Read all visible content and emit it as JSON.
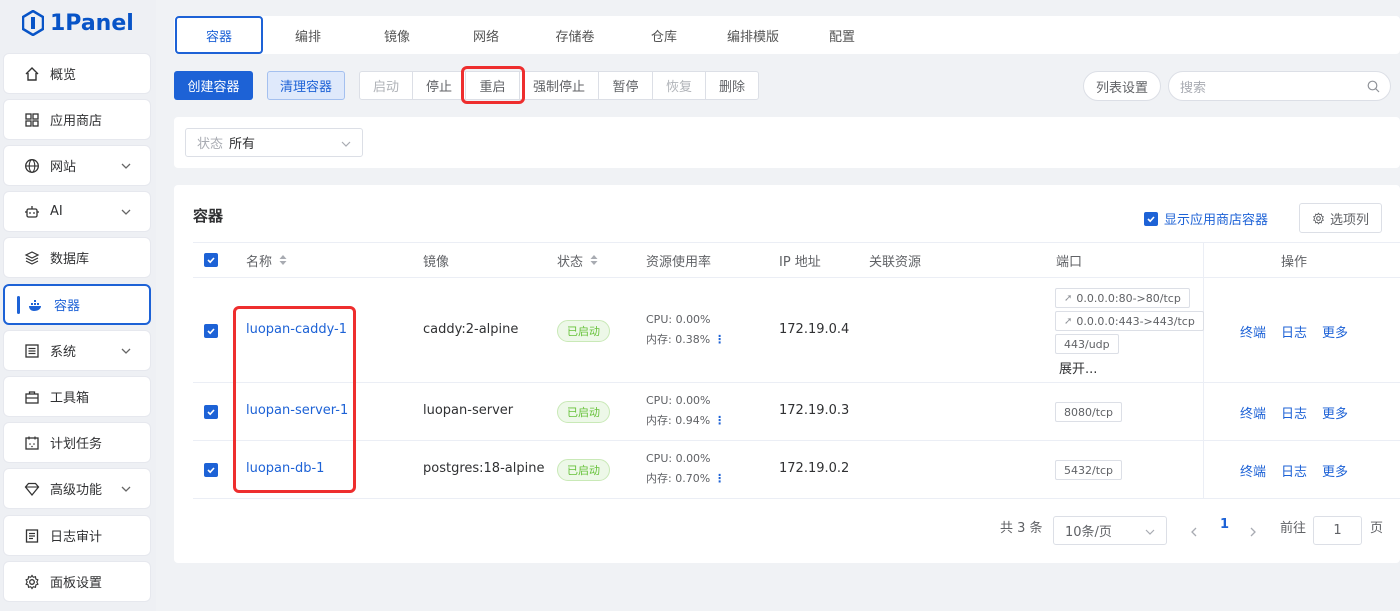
{
  "app": {
    "name": "1Panel"
  },
  "sidebar": {
    "items": [
      {
        "label": "概览",
        "icon": "home-icon"
      },
      {
        "label": "应用商店",
        "icon": "grid-icon"
      },
      {
        "label": "网站",
        "icon": "globe-icon",
        "expandable": true
      },
      {
        "label": "AI",
        "icon": "robot-icon",
        "expandable": true
      },
      {
        "label": "数据库",
        "icon": "layers-icon"
      },
      {
        "label": "容器",
        "icon": "docker-icon",
        "active": true
      },
      {
        "label": "系统",
        "icon": "system-icon",
        "expandable": true
      },
      {
        "label": "工具箱",
        "icon": "toolbox-icon"
      },
      {
        "label": "计划任务",
        "icon": "calendar-icon"
      },
      {
        "label": "高级功能",
        "icon": "diamond-icon",
        "expandable": true
      },
      {
        "label": "日志审计",
        "icon": "log-icon"
      },
      {
        "label": "面板设置",
        "icon": "gear-icon"
      }
    ]
  },
  "tabs": [
    "容器",
    "编排",
    "镜像",
    "网络",
    "存储卷",
    "仓库",
    "编排模版",
    "配置"
  ],
  "toolbar": {
    "create": "创建容器",
    "clean": "清理容器",
    "group": [
      {
        "label": "启动",
        "disabled": true
      },
      {
        "label": "停止",
        "disabled": false
      },
      {
        "label": "重启",
        "disabled": false
      },
      {
        "label": "强制停止",
        "disabled": false
      },
      {
        "label": "暂停",
        "disabled": false
      },
      {
        "label": "恢复",
        "disabled": true
      },
      {
        "label": "删除",
        "disabled": false
      }
    ],
    "list_settings": "列表设置",
    "search_placeholder": "搜索"
  },
  "filter": {
    "status_prefix": "状态",
    "status_value": "所有"
  },
  "card": {
    "title": "容器",
    "show_app_store": "显示应用商店容器",
    "column_options": "选项列"
  },
  "table": {
    "headers": {
      "name": "名称",
      "image": "镜像",
      "status": "状态",
      "resource": "资源使用率",
      "ip": "IP 地址",
      "related": "关联资源",
      "port": "端口",
      "actions": "操作"
    },
    "rows": [
      {
        "name": "luopan-caddy-1",
        "image": "caddy:2-alpine",
        "status": "已启动",
        "cpu": "CPU: 0.00%",
        "mem": "内存: 0.38%",
        "ip": "172.19.0.4",
        "ports": [
          "0.0.0.0:80->80/tcp",
          "0.0.0.0:443->443/tcp",
          "443/udp"
        ],
        "expand": "展开..."
      },
      {
        "name": "luopan-server-1",
        "image": "luopan-server",
        "status": "已启动",
        "cpu": "CPU: 0.00%",
        "mem": "内存: 0.94%",
        "ip": "172.19.0.3",
        "ports": [
          "8080/tcp"
        ]
      },
      {
        "name": "luopan-db-1",
        "image": "postgres:18-alpine",
        "status": "已启动",
        "cpu": "CPU: 0.00%",
        "mem": "内存: 0.70%",
        "ip": "172.19.0.2",
        "ports": [
          "5432/tcp"
        ]
      }
    ],
    "actions": {
      "terminal": "终端",
      "log": "日志",
      "more": "更多"
    }
  },
  "pagination": {
    "total": "共 3 条",
    "page_size": "10条/页",
    "current": "1",
    "goto_prefix": "前往",
    "goto_value": "1",
    "goto_suffix": "页"
  },
  "colors": {
    "accent": "#1d62d6",
    "highlight": "#ee2e2e",
    "success": "#67c23a"
  }
}
